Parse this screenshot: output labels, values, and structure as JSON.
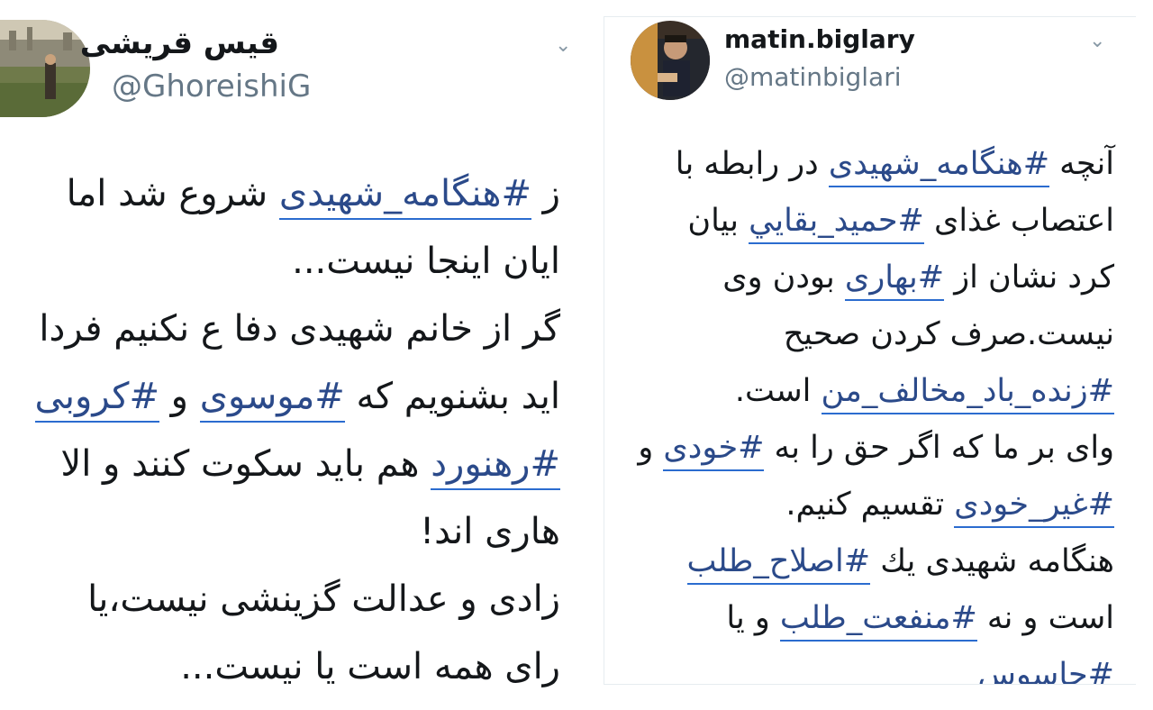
{
  "left_tweet": {
    "name": "قیس قریشی",
    "handle": "@GhoreishiG",
    "lines": [
      {
        "before": "ز ",
        "tag": "#هنگامه_شهیدی",
        "after": " شروع شد اما"
      },
      {
        "before": "ایان اینجا نیست..."
      },
      {
        "before": "گر از خانم شهیدی دفا ع نکنیم فردا"
      },
      {
        "before": "اید بشنویم که ",
        "tag": "#موسوی",
        "after": " و ",
        "tag2": "#کروبی"
      },
      {
        "before": "",
        "tag": "#رهنورد",
        "after": " هم باید سکوت کنند و الا"
      },
      {
        "before": "هاری اند!"
      },
      {
        "before": "زادی و عدالت گزینشی نیست،یا"
      },
      {
        "before": "رای همه است یا نیست..."
      }
    ]
  },
  "right_tweet": {
    "name": "matin.biglary",
    "handle": "@matinbiglari",
    "lines": [
      {
        "before": "آنچه ",
        "tag": "#هنگامه_شهیدی",
        "after": " در رابطه با"
      },
      {
        "before": "اعتصاب غذای ",
        "tag": "#حمید_بقایي",
        "after": "  بیان"
      },
      {
        "before": "کرد نشان از ",
        "tag": "#بهاری",
        "after": " بودن وی"
      },
      {
        "before": "نیست.صرف کردن صحیح"
      },
      {
        "before": "",
        "tag": "#زنده_باد_مخالف_من",
        "after": " است."
      },
      {
        "before": "وای بر ما که اگر حق را به ",
        "tag": "#خودی",
        "after": " و"
      },
      {
        "before": "",
        "tag": "#غیر_خودی",
        "after": " تقسیم کنیم."
      },
      {
        "before": "هنگامه شهیدی يك ",
        "tag": "#اصلاح_طلب"
      },
      {
        "before": "است و نه ",
        "tag": "#منفعت_طلب",
        "after": " و یا"
      },
      {
        "before": "",
        "tag": "#جاسوس"
      }
    ]
  },
  "icons": {
    "more": "chevron-down-icon"
  },
  "colors": {
    "hashtag": "#2b4a8a",
    "underline": "#2b6ccf",
    "handle": "#657786"
  }
}
